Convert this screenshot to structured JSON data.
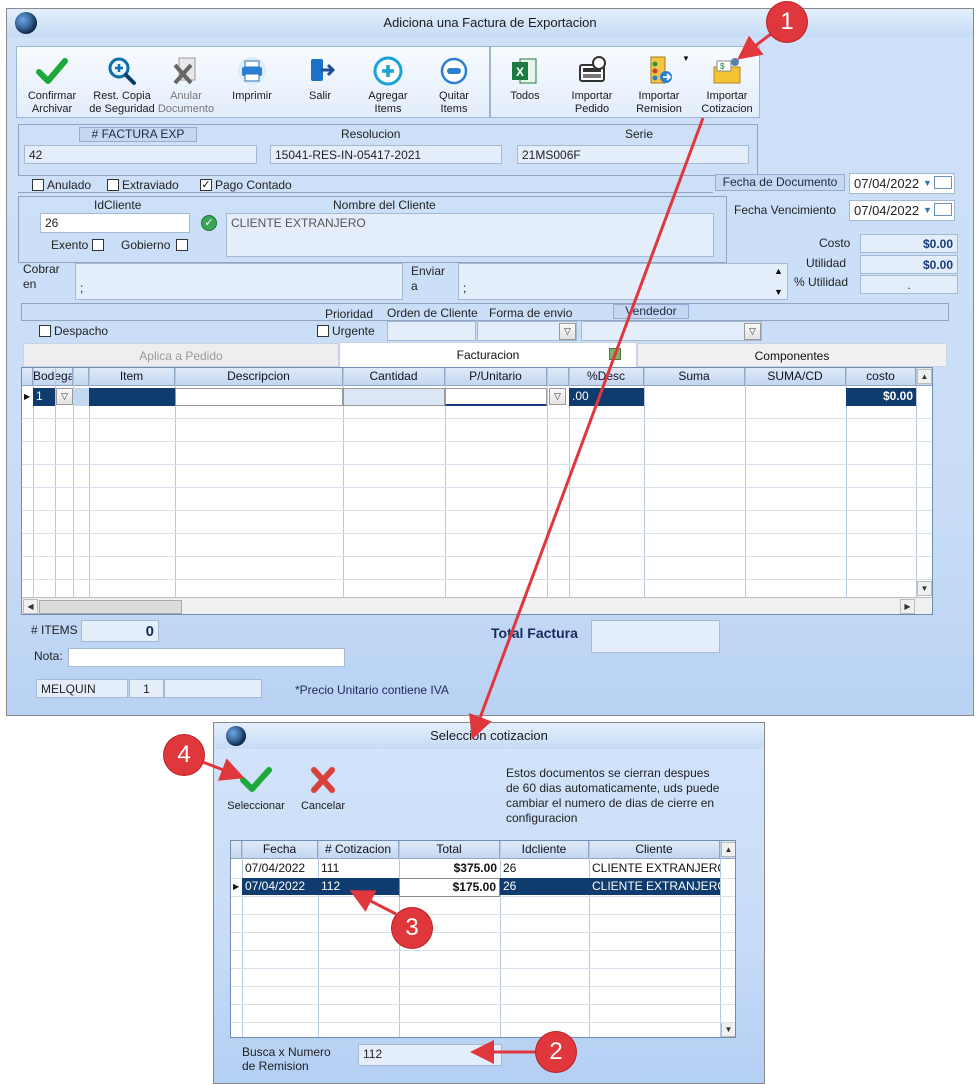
{
  "main_window": {
    "title": "Adiciona una Factura de Exportacion",
    "toolbar": [
      {
        "label_1": "Confirmar",
        "label_2": "Archivar",
        "icon": "check-icon",
        "disabled": false
      },
      {
        "label_1": "Rest. Copia",
        "label_2": "de Seguridad",
        "icon": "magnifier-plus-icon",
        "disabled": false
      },
      {
        "label_1": "Anular",
        "label_2": "Documento",
        "icon": "cancel-document-icon",
        "disabled": true
      },
      {
        "label_1": "Imprimir",
        "label_2": "",
        "icon": "printer-icon",
        "disabled": false
      },
      {
        "label_1": "Salir",
        "label_2": "",
        "icon": "exit-door-icon",
        "disabled": false
      },
      {
        "label_1": "Agregar",
        "label_2": "Items",
        "icon": "plus-circle-icon",
        "disabled": false
      },
      {
        "label_1": "Quitar",
        "label_2": "Items",
        "icon": "minus-circle-icon",
        "disabled": false
      },
      {
        "label_1": "Todos",
        "label_2": "",
        "icon": "excel-icon",
        "disabled": false
      },
      {
        "label_1": "Importar",
        "label_2": "Pedido",
        "icon": "register-import-icon",
        "disabled": false
      },
      {
        "label_1": "Importar",
        "label_2": "Remision",
        "icon": "remision-import-icon",
        "disabled": false
      },
      {
        "label_1": "Importar",
        "label_2": "Cotizacion",
        "icon": "cotizacion-import-icon",
        "disabled": false
      }
    ],
    "header": {
      "factura_label": "# FACTURA EXP",
      "factura_value": "42",
      "resolucion_label": "Resolucion",
      "resolucion_value": "15041-RES-IN-05417-2021",
      "serie_label": "Serie",
      "serie_value": "21MS006F"
    },
    "checks": {
      "anulado": "Anulado",
      "extraviado": "Extraviado",
      "pago_contado": "Pago Contado",
      "pago_contado_checked": true
    },
    "fecha_documento_label": "Fecha de  Documento",
    "fecha_documento_value": "07/04/2022",
    "fecha_vencimiento_label": "Fecha Vencimiento",
    "fecha_vencimiento_value": "07/04/2022",
    "cliente": {
      "id_label": "IdCliente",
      "id_value": "26",
      "nombre_label": "Nombre del Cliente",
      "nombre_value": "CLIENTE EXTRANJERO",
      "exento": "Exento",
      "gobierno": "Gobierno"
    },
    "costos": {
      "costo_label": "Costo",
      "costo_value": "$0.00",
      "utilidad_label": "Utilidad",
      "utilidad_value": "$0.00",
      "pct_utilidad_label": "% Utilidad",
      "pct_utilidad_value": "."
    },
    "cobrar_label_1": "Cobrar",
    "cobrar_label_2": "en",
    "cobrar_value": ";",
    "enviar_label_1": "Enviar",
    "enviar_label_2": "a",
    "enviar_value": ";",
    "prioridad_label": "Prioridad",
    "orden_label": "Orden de Cliente",
    "forma_envio_label": "Forma de envio",
    "vendedor_label": "Vendedor",
    "despacho": "Despacho",
    "urgente": "Urgente",
    "tabs": [
      "Aplica a Pedido",
      "Facturacion",
      "Componentes"
    ],
    "grid_columns": [
      "Bodega",
      "Item",
      "Descripcion",
      "Cantidad",
      "P/Unitario",
      "%Desc",
      "Suma",
      "SUMA/CD",
      "costo"
    ],
    "grid_row": {
      "bodega": "1",
      "desc": ".00",
      "costo": "$0.00"
    },
    "items_label": "# ITEMS",
    "items_value": "0",
    "total_factura_label": "Total Factura",
    "nota_label": "Nota:",
    "status_user": "MELQUIN",
    "status_num": "1",
    "iva_note": "*Precio Unitario contiene IVA"
  },
  "dialog": {
    "title": "Seleccion cotizacion",
    "select_label": "Seleccionar",
    "cancel_label": "Cancelar",
    "info_text_1": "Estos documentos se cierran despues",
    "info_text_2": "de 60 dias automaticamente, uds puede",
    "info_text_3": "cambiar el numero de dias de cierre en",
    "info_text_4": "configuracion",
    "columns": [
      "Fecha",
      "# Cotizacion",
      "Total",
      "Idcliente",
      "Cliente"
    ],
    "rows": [
      {
        "fecha": "07/04/2022",
        "cotizacion": "111",
        "total": "$375.00",
        "idcliente": "26",
        "cliente": "CLIENTE EXTRANJERO"
      },
      {
        "fecha": "07/04/2022",
        "cotizacion": "112",
        "total": "$175.00",
        "idcliente": "26",
        "cliente": "CLIENTE EXTRANJERO"
      }
    ],
    "search_label_1": "Busca x Numero",
    "search_label_2": "de Remision",
    "search_value": "112"
  },
  "annotations": [
    "1",
    "2",
    "3",
    "4"
  ],
  "colors": {
    "badge": "#e0373c",
    "selection": "#0f3b6e",
    "arrow": "#e0373c"
  }
}
